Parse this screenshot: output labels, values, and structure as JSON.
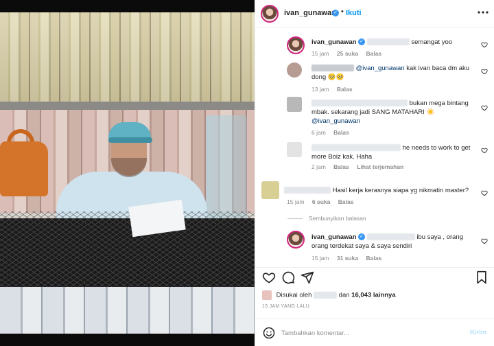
{
  "header": {
    "username": "ivan_gunawan",
    "separator": "•",
    "follow_label": "Ikuti",
    "more_icon": "more-horizontal-icon"
  },
  "comments": [
    {
      "author": "ivan_gunawan",
      "verified": true,
      "text": "semangat yoo",
      "time": "15 jam",
      "likes": "25 suka",
      "reply": "Balas"
    },
    {
      "author": "",
      "mention": "@ivan_gunawan",
      "text": "kak ivan baca dm aku dong 🥺🥺",
      "time": "13 jam",
      "reply": "Balas"
    },
    {
      "author": "",
      "text": "bukan mega bintang mbak. sekarang jadi SANG MATAHARI ☀️",
      "mention": "@ivan_gunawan",
      "time": "6 jam",
      "reply": "Balas"
    },
    {
      "author": "",
      "text": "he needs to work to get more Boiz kak. Haha",
      "time": "2 jam",
      "reply": "Balas",
      "translate": "Lihat terjemahan"
    },
    {
      "author": "",
      "text": "Hasil kerja kerasnya siapa yg nikmatin master?",
      "time": "15 jam",
      "likes": "6 suka",
      "reply": "Balas"
    },
    {
      "author": "ivan_gunawan",
      "verified": true,
      "text": "ibu saya , orang orang terdekat saya & saya sendiri",
      "time": "15 jam",
      "likes": "31 suka",
      "reply": "Balas"
    }
  ],
  "hide_replies": "Sembunyikan balasan",
  "likes": {
    "prefix": "Disukai oleh",
    "joiner": "dan",
    "count": "16,043 lainnya"
  },
  "timestamp": "15 JAM YANG LALU",
  "composer": {
    "placeholder": "Tambahkan komentar...",
    "post_label": "Kirim"
  },
  "colors": {
    "accent": "#0095f6",
    "verified": "#3897f0",
    "muted": "#8e8e8e"
  }
}
